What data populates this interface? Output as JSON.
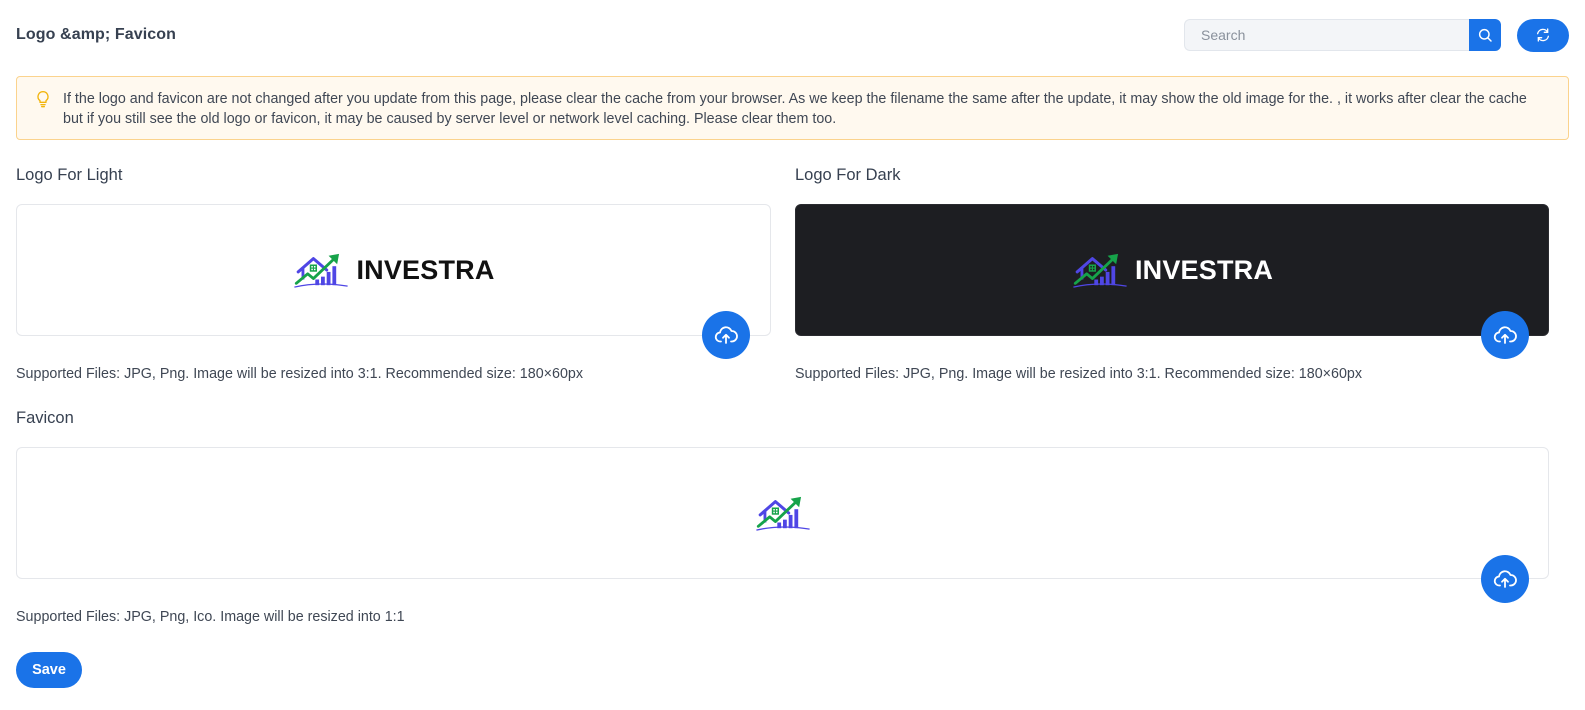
{
  "header": {
    "title": "Logo &amp; Favicon",
    "search_placeholder": "Search",
    "search_icon": "search-icon",
    "refresh_icon": "refresh-icon"
  },
  "alert": {
    "icon": "lightbulb-icon",
    "text": "If the logo and favicon are not changed after you update from this page, please clear the cache from your browser. As we keep the filename the same after the update, it may show the old image for the. , it works after clear the cache but if you still see the old logo or favicon, it may be caused by server level or network level caching. Please clear them too."
  },
  "logo_light": {
    "label": "Logo For Light",
    "brand": "INVESTRA",
    "help": "Supported Files: JPG, Png. Image will be resized into 3:1. Recommended size: 180×60px"
  },
  "logo_dark": {
    "label": "Logo For Dark",
    "brand": "INVESTRA",
    "help": "Supported Files: JPG, Png. Image will be resized into 3:1. Recommended size: 180×60px"
  },
  "favicon": {
    "label": "Favicon",
    "help": "Supported Files: JPG, Png, Ico. Image will be resized into 1:1"
  },
  "actions": {
    "save_label": "Save",
    "upload_icon": "cloud-upload-icon"
  },
  "colors": {
    "primary": "#1a73e8",
    "dark_box": "#1d1e22",
    "alert_bg": "#fff9ef",
    "alert_border": "#fbd38d",
    "brand_purple": "#4f46e5",
    "brand_green": "#16a34a"
  }
}
